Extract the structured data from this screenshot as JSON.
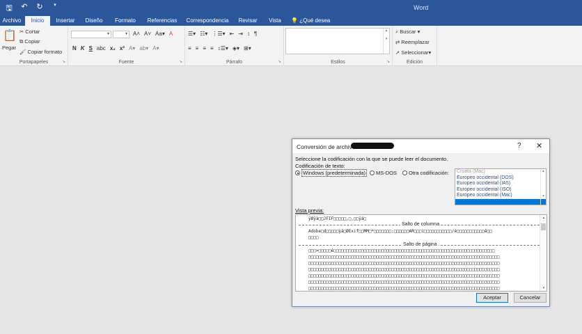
{
  "app": {
    "title": "Word"
  },
  "qat": {
    "save_icon": "save-icon",
    "undo_icon": "undo-icon",
    "redo_icon": "redo-icon",
    "customize_icon": "customize-icon"
  },
  "tabs": [
    "Archivo",
    "Inicio",
    "Insertar",
    "Diseño",
    "Formato",
    "Referencias",
    "Correspondencia",
    "Revisar",
    "Vista"
  ],
  "tell_me": "¿Qué desea hacer?",
  "ribbon": {
    "clipboard": {
      "paste": "Pegar",
      "cut": "Cortar",
      "copy": "Copiar",
      "format_painter": "Copiar formato",
      "label": "Portapapeles"
    },
    "font": {
      "label": "Fuente",
      "bold": "N",
      "italic": "K",
      "underline": "S"
    },
    "paragraph": {
      "label": "Párrafo"
    },
    "styles": {
      "label": "Estilos"
    },
    "editing": {
      "find": "Buscar",
      "replace": "Reemplazar",
      "select": "Seleccionar",
      "label": "Edición"
    }
  },
  "dialog": {
    "title": "Conversión de archivo",
    "help": "?",
    "close": "✕",
    "instruction": "Seleccione la codificación con la que se puede leer el documento.",
    "encoding_label": "Codificación de texto:",
    "options": [
      "Windows (predeterminada)",
      "MS-DOS",
      "Otra codificación:"
    ],
    "encodings": [
      "Croata (Mac)",
      "Europeo occidental (DOS)",
      "Europeo occidental (IA5)",
      "Europeo occidental (ISO)",
      "Europeo occidental (Mac)",
      "Europeo occidental (Windows)"
    ],
    "preview_label": "Vista previa:",
    "preview": {
      "line1": "ÿØÿà□□JFIF□□□□□,□,□□ÿá□",
      "break1": "Salto de columna",
      "line2": "Adobe□d□□□□□ÿá□ØExif□□MM□*□□□□□□□;□□□□□□AR□□□i□□□□□□□□□□□/é□□□□□□□□□□□ê□□",
      "line3": "□□□□",
      "break2": "Salto de página",
      "line4": "□□□>□□□□□é□□□□□□□□□□□□□□□□□□□□□□□□□□□□□□□□□□□□□□□□□□□□□□□□□□□□□□□□□□□□□□□□",
      "fill": "□□□□□□□□□□□□□□□□□□□□□□□□□□□□□□□□□□□□□□□□□□□□□□□□□□□□□□□□□□□□□□□□□□□□□□□□□□□□"
    },
    "accept": "Aceptar",
    "cancel": "Cancelar"
  }
}
